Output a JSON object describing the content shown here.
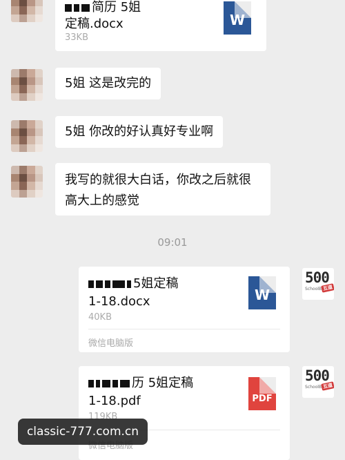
{
  "messages": [
    {
      "type": "file",
      "name_line1": "简历 5姐",
      "name_line2": "定稿.docx",
      "size": "33KB",
      "icon": "word-doc-icon",
      "icon_glyph": "W"
    },
    {
      "type": "text",
      "text": "5姐  这是改完的"
    },
    {
      "type": "text",
      "text": "5姐  你改的好认真好专业啊"
    },
    {
      "type": "text",
      "line1": "我写的就很大白话，你改之后就很",
      "line2": "高大上的感觉"
    }
  ],
  "timestamp": "09:01",
  "outgoing": [
    {
      "name_line1": "5姐定稿",
      "name_line2": "1-18.docx",
      "size": "40KB",
      "source": "微信电脑版",
      "icon": "word-doc-icon",
      "icon_glyph": "W"
    },
    {
      "name_line1": "历 5姐定稿",
      "name_line2": "1-18.pdf",
      "size": "119KB",
      "source": "微信电脑版",
      "icon": "pdf-file-icon",
      "icon_glyph": "PDF"
    }
  ],
  "sender_avatar": {
    "logo_text": "500",
    "logo_sub": "SchoolBOX",
    "logo_badge": "五道"
  },
  "colors": {
    "background": "#ededed",
    "word_blue": "#2b5797",
    "pdf_red": "#e0443e"
  },
  "watermark": "classic-777.com.cn"
}
